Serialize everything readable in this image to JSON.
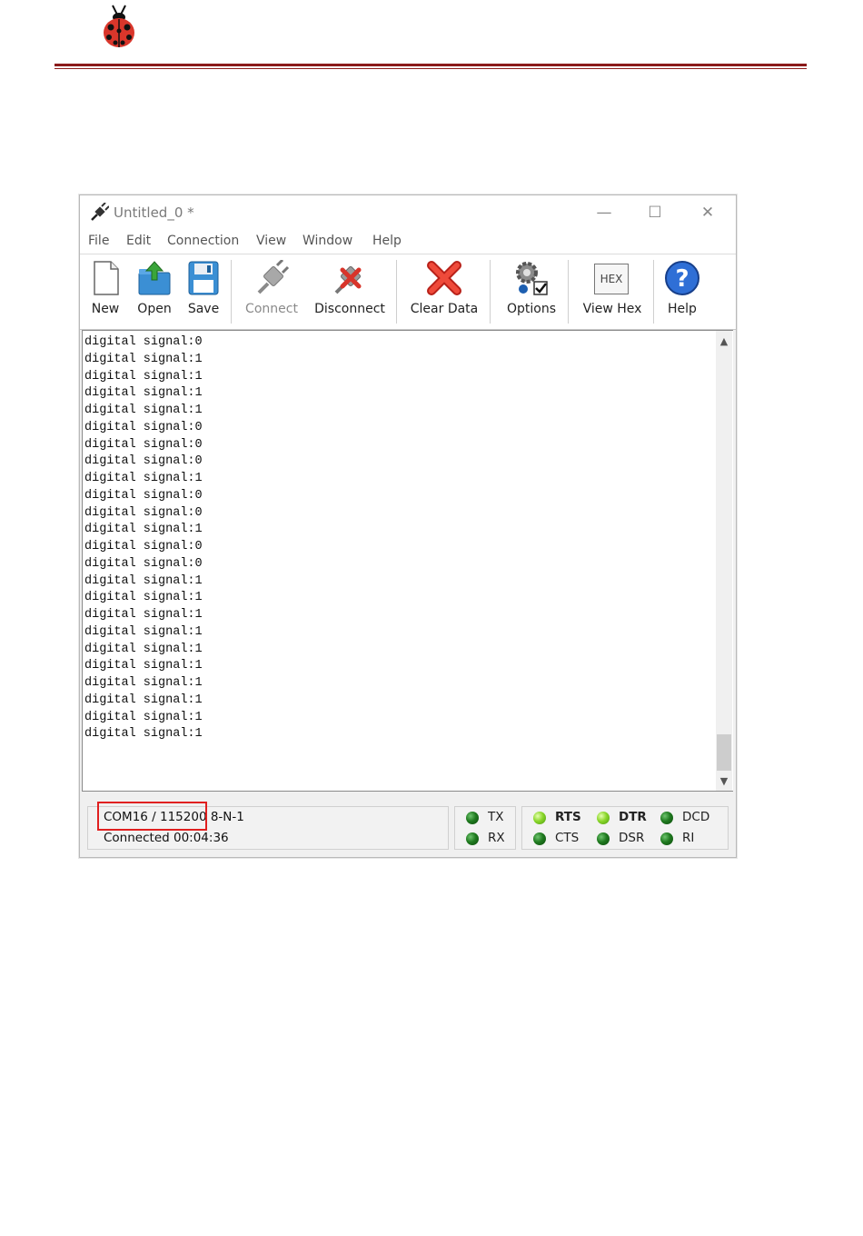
{
  "window": {
    "title": "Untitled_0 *"
  },
  "menu": [
    "File",
    "Edit",
    "Connection",
    "View",
    "Window",
    "Help"
  ],
  "toolbar": {
    "new": "New",
    "open": "Open",
    "save": "Save",
    "connect": "Connect",
    "disconnect": "Disconnect",
    "clear": "Clear Data",
    "options": "Options",
    "viewhex": "View Hex",
    "hex_badge": "HEX",
    "help": "Help"
  },
  "terminal": {
    "lines": [
      "digital signal:0",
      "digital signal:1",
      "digital signal:1",
      "digital signal:1",
      "digital signal:1",
      "digital signal:0",
      "digital signal:0",
      "digital signal:0",
      "digital signal:1",
      "digital signal:0",
      "digital signal:0",
      "digital signal:1",
      "digital signal:0",
      "digital signal:0",
      "digital signal:1",
      "digital signal:1",
      "digital signal:1",
      "digital signal:1",
      "digital signal:1",
      "digital signal:1",
      "digital signal:1",
      "digital signal:1",
      "digital signal:1",
      "digital signal:1"
    ]
  },
  "status": {
    "port": "COM16 / 115200 8-N-1",
    "connected": "Connected 00:04:36",
    "signals": [
      {
        "label": "TX",
        "state": "dark",
        "bold": false
      },
      {
        "label": "RX",
        "state": "dark",
        "bold": false
      },
      {
        "label": "RTS",
        "state": "bright",
        "bold": true
      },
      {
        "label": "CTS",
        "state": "dark",
        "bold": false
      },
      {
        "label": "DTR",
        "state": "bright",
        "bold": true
      },
      {
        "label": "DSR",
        "state": "dark",
        "bold": false
      },
      {
        "label": "DCD",
        "state": "dark",
        "bold": false
      },
      {
        "label": "RI",
        "state": "dark",
        "bold": false
      }
    ]
  },
  "colors": {
    "highlight": "#e02020",
    "rule": "#8b1a1a",
    "led_dark": "#1f7a1f",
    "led_bright": "#8ad62a"
  }
}
